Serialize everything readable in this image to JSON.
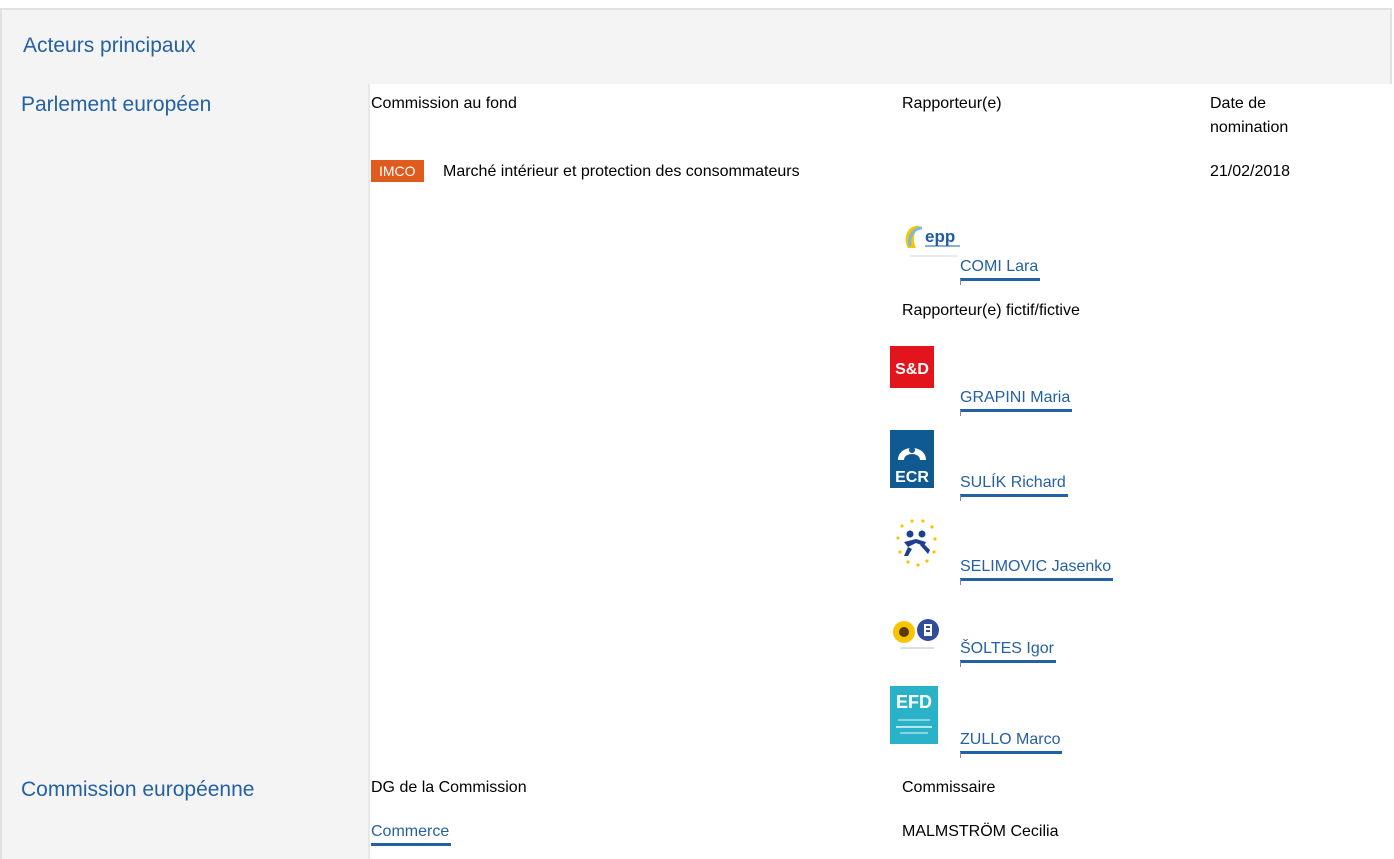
{
  "header": {
    "title": "Acteurs principaux"
  },
  "parliament": {
    "title": "Parlement européen",
    "col_committee": "Commission au fond",
    "col_rapporteur": "Rapporteur(e)",
    "col_date": "Date de nomination",
    "committee_badge": "IMCO",
    "committee_name": "Marché intérieur et protection des consommateurs",
    "nomination_date": "21/02/2018",
    "rapporteur": {
      "name": "COMI Lara",
      "group_logo": "epp-logo"
    },
    "shadow_label": "Rapporteur(e) fictif/fictive",
    "shadows": [
      {
        "name": "GRAPINI Maria",
        "group_logo": "sd-logo"
      },
      {
        "name": "SULÍK Richard",
        "group_logo": "ecr-logo"
      },
      {
        "name": "SELIMOVIC Jasenko",
        "group_logo": "alde-logo"
      },
      {
        "name": "ŠOLTES Igor",
        "group_logo": "greens-efa-logo"
      },
      {
        "name": "ZULLO Marco",
        "group_logo": "efdd-logo"
      }
    ]
  },
  "commission": {
    "title": "Commission européenne",
    "col_dg": "DG de la Commission",
    "col_commissioner": "Commissaire",
    "dg": "Commerce",
    "commissioner": "MALMSTRÖM Cecilia"
  },
  "logo_text": {
    "epp": "epp",
    "sd": "S&D",
    "ecr": "ECR",
    "efdd": "EFD"
  },
  "colors": {
    "accent": "#2461a3",
    "badge": "#e05c1e",
    "sd_red": "#e3141c",
    "ecr_blue": "#0e5a91",
    "efdd_teal": "#2ab2c8"
  }
}
